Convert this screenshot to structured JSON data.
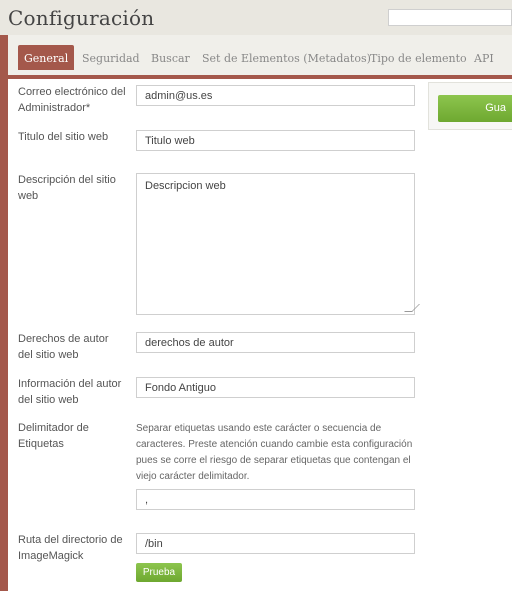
{
  "header": {
    "title": "Configuración",
    "search_value": ""
  },
  "tabs": [
    {
      "label": "General",
      "active": true
    },
    {
      "label": "Seguridad"
    },
    {
      "label": "Buscar"
    },
    {
      "label": "Set de Elementos (Metadatos)"
    },
    {
      "label": "Tipo de elemento"
    },
    {
      "label": "API"
    }
  ],
  "form": {
    "admin_email": {
      "label": "Correo electrónico del Administrador*",
      "value": "admin@us.es"
    },
    "site_title": {
      "label": "Titulo del sitio web",
      "value": "Titulo web"
    },
    "site_description": {
      "label": "Descripción del sitio web",
      "value": "Descripcion web"
    },
    "copyright": {
      "label": "Derechos de autor del sitio web",
      "value": "derechos de autor"
    },
    "author": {
      "label": "Información del autor del sitio web",
      "value": "Fondo Antiguo"
    },
    "tag_delimiter": {
      "label": "Delimitador de Etiquetas",
      "help": "Separar etiquetas usando este carácter o secuencia de caracteres. Preste atención cuando cambie esta configuración pues se corre el riesgo de separar etiquetas que contengan el viejo carácter delimitador.",
      "value": ","
    },
    "imagemagick": {
      "label": "Ruta del directorio de ImageMagick",
      "value": "/bin",
      "test_button": "Prueba"
    }
  },
  "actions": {
    "save_label": "Gua"
  },
  "colors": {
    "accent": "#a4584b",
    "button_green": "#7ab53c"
  }
}
